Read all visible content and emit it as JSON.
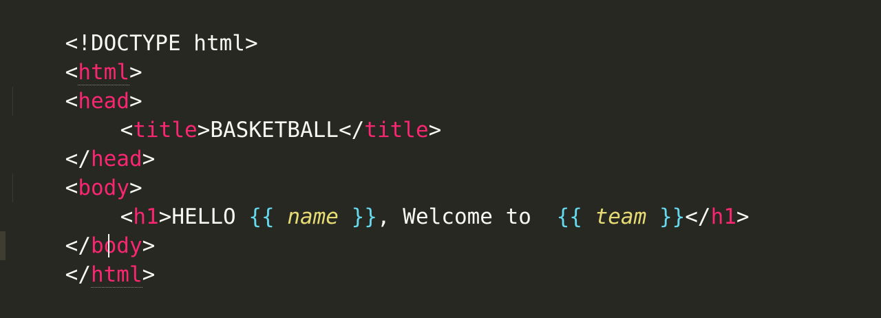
{
  "editor": {
    "theme_colors": {
      "background": "#272822",
      "tag": "#f92672",
      "text": "#f8f8f2",
      "brace": "#66d9ef",
      "variable": "#e6db74"
    },
    "lines": {
      "doctype": "<!DOCTYPE html>",
      "html_open_tag": "html",
      "head_open_tag": "head",
      "title_tag": "title",
      "title_text": "BASKETBALL",
      "head_close_tag": "head",
      "body_open_tag": "body",
      "h1_tag": "h1",
      "hello_text": "HELLO ",
      "var_open": "{{",
      "var_name": "name",
      "var_close": "}}",
      "welcome_text": ", Welcome to ",
      "var_team": "team",
      "body_close_tag": "body",
      "html_close_tag": "html"
    },
    "punctuation": {
      "lt": "<",
      "gt": ">",
      "lt_slash": "</",
      "space": " "
    }
  }
}
